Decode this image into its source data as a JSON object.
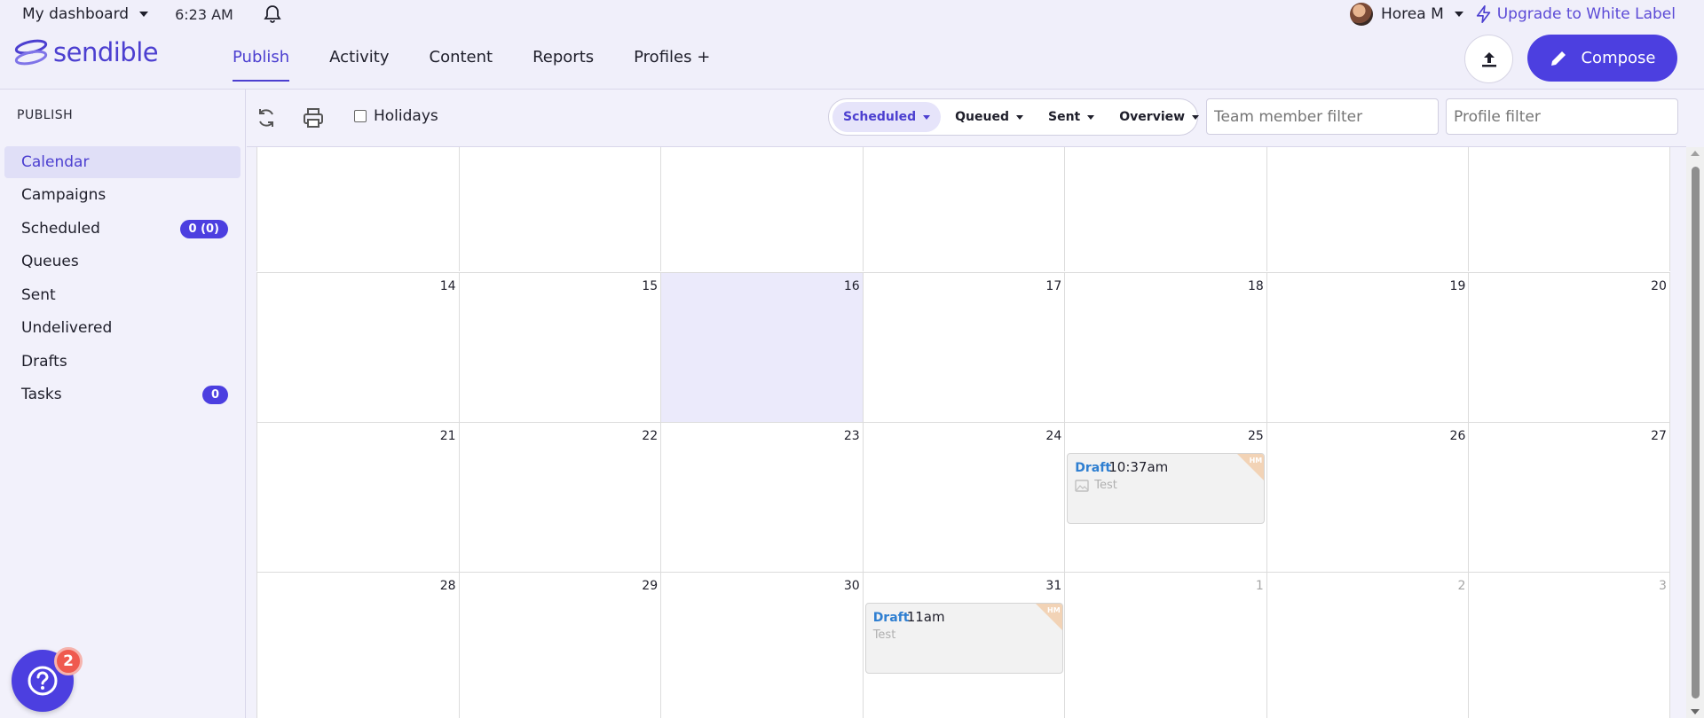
{
  "utility": {
    "dashboard_label": "My dashboard",
    "time": "6:23 AM",
    "user_name": "Horea M",
    "upgrade_label": "Upgrade to White Label"
  },
  "header": {
    "logo_text": "sendible",
    "nav": [
      "Publish",
      "Activity",
      "Content",
      "Reports",
      "Profiles +"
    ],
    "compose_label": "Compose"
  },
  "sidebar": {
    "heading": "PUBLISH",
    "items": [
      {
        "label": "Calendar",
        "active": true
      },
      {
        "label": "Campaigns"
      },
      {
        "label": "Scheduled",
        "badge": "0 (0)"
      },
      {
        "label": "Queues"
      },
      {
        "label": "Sent"
      },
      {
        "label": "Undelivered"
      },
      {
        "label": "Drafts"
      },
      {
        "label": "Tasks",
        "badge": "0"
      }
    ]
  },
  "toolbar": {
    "holidays_label": "Holidays",
    "segments": [
      "Scheduled",
      "Queued",
      "Sent",
      "Overview"
    ],
    "team_filter_placeholder": "Team member filter",
    "profile_filter_placeholder": "Profile filter"
  },
  "calendar": {
    "rows": [
      [
        "",
        "",
        "",
        "",
        "",
        "",
        ""
      ],
      [
        "14",
        "15",
        "16",
        "17",
        "18",
        "19",
        "20"
      ],
      [
        "21",
        "22",
        "23",
        "24",
        "25",
        "26",
        "27"
      ],
      [
        "28",
        "29",
        "30",
        "31",
        "1",
        "2",
        "3"
      ]
    ],
    "today": "16",
    "muted_days": [
      "1",
      "2",
      "3"
    ],
    "events": [
      {
        "day": "25",
        "status": "Draft",
        "time": "10:37am",
        "text": "Test",
        "owner_initials": "HM",
        "has_image_icon": true
      },
      {
        "day": "31",
        "status": "Draft",
        "time": "11am",
        "text": "Test",
        "owner_initials": "HM",
        "has_image_icon": false
      }
    ]
  },
  "help": {
    "badge_count": "2"
  },
  "colors": {
    "brand": "#4c3fe0",
    "draft_status": "#2f7fd1",
    "today_bg": "#ebeafb"
  }
}
